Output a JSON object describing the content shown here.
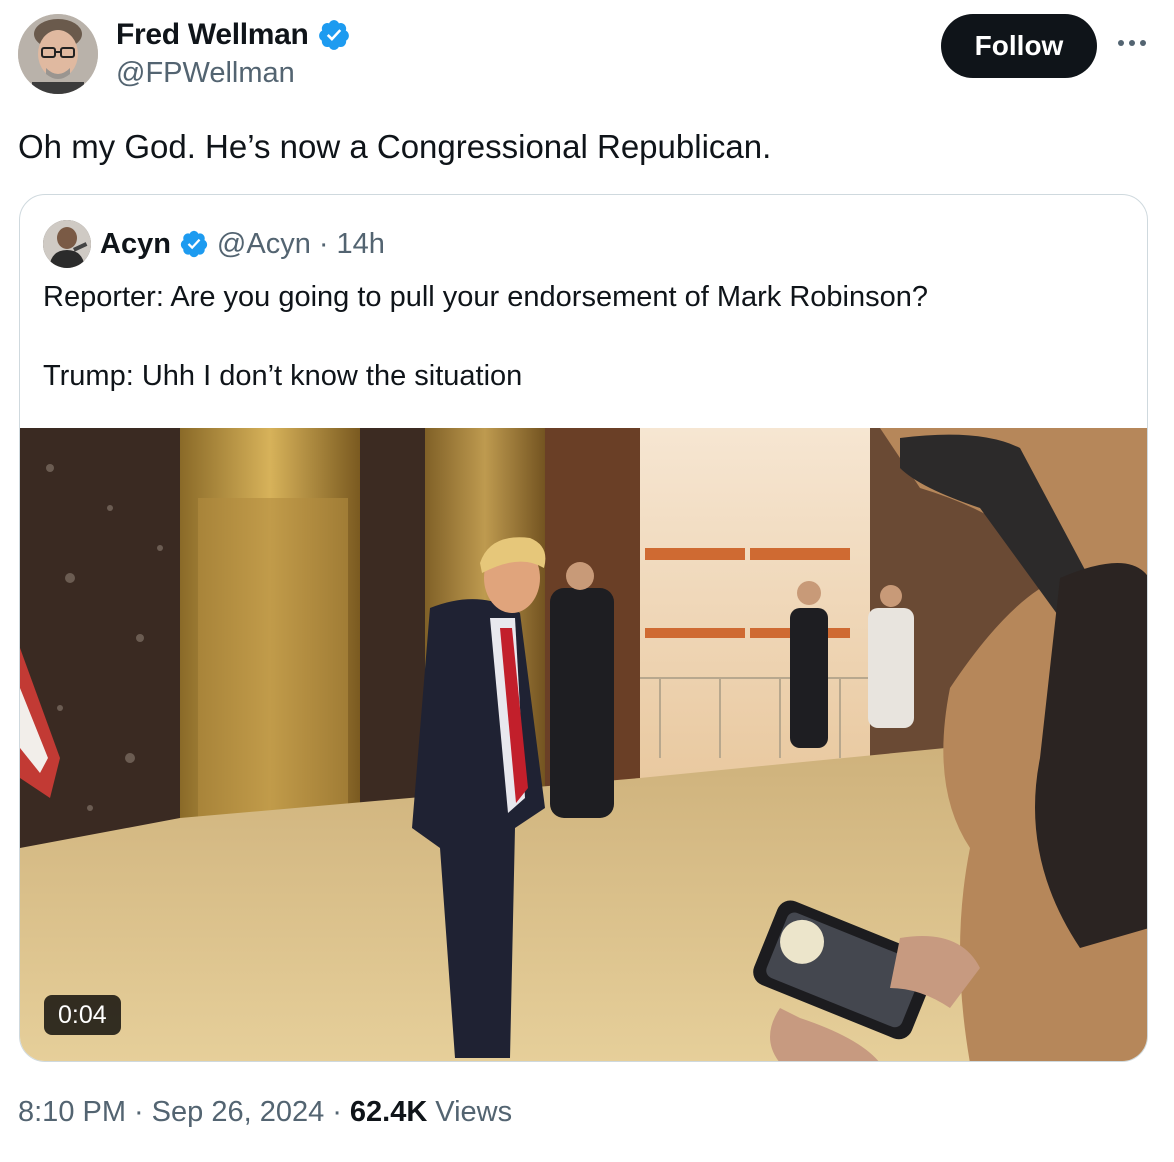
{
  "author": {
    "display_name": "Fred Wellman",
    "handle": "@FPWellman",
    "avatar_icon": "author-avatar-photo",
    "verified_icon": "verified-badge-icon"
  },
  "follow_label": "Follow",
  "tweet_text": "Oh my God. He’s now a Congressional Republican.",
  "quote": {
    "display_name": "Acyn",
    "handle": "@Acyn",
    "separator": "·",
    "time": "14h",
    "line1": "Reporter: Are you going to pull your endorsement of Mark Robinson?",
    "line2": "Trump: Uhh I don’t know the situation",
    "video_duration": "0:04"
  },
  "meta": {
    "time": "8:10 PM",
    "sep1": "·",
    "date": "Sep 26, 2024",
    "sep2": "·",
    "views_count": "62.4K",
    "views_label": "Views"
  },
  "colors": {
    "text": "#0f1419",
    "muted": "#536471",
    "verified": "#1d9bf0",
    "follow_bg": "#0f1419",
    "border": "#cfd9de"
  }
}
